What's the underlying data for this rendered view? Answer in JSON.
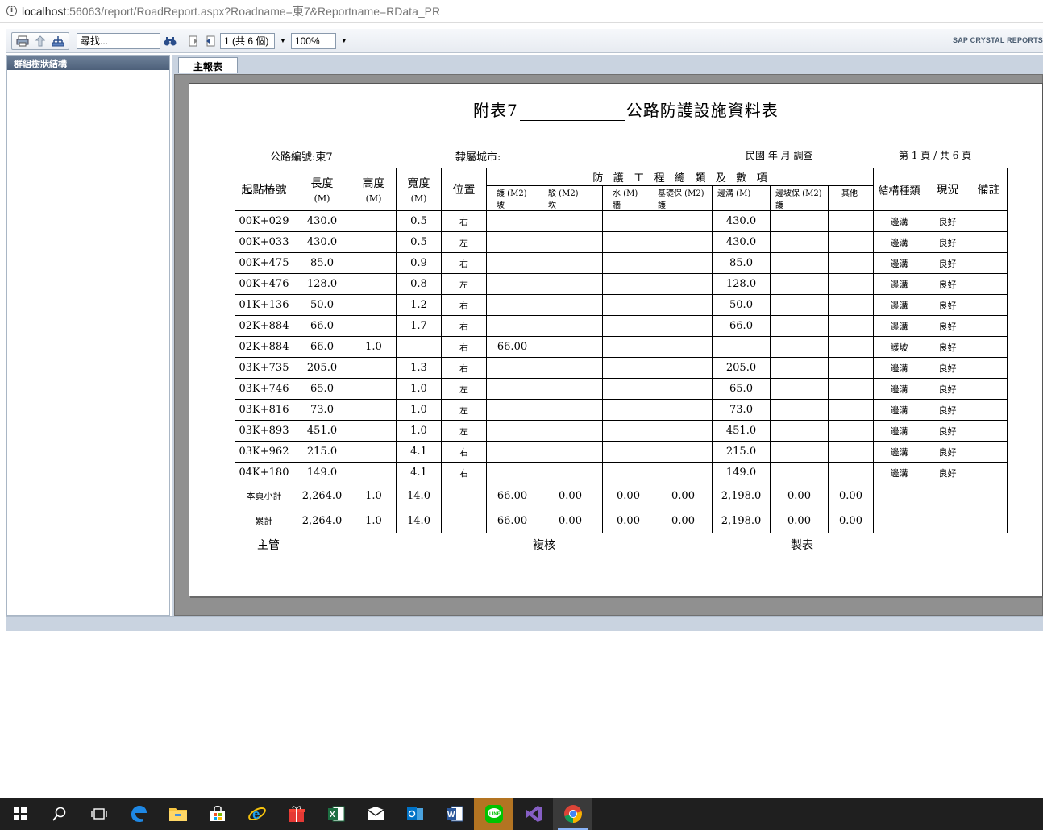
{
  "browser": {
    "url_host": "localhost",
    "url_path": ":56063/report/RoadReport.aspx?Roadname=東7&Reportname=RData_PR"
  },
  "toolbar": {
    "search_value": "尋找...",
    "page_indicator": "1 (共 6 個)",
    "zoom": "100%",
    "brand": "SAP CRYSTAL REPORTS"
  },
  "left_panel": {
    "header": "群組樹狀結構"
  },
  "tabs": {
    "main": "主報表"
  },
  "report": {
    "title_prefix": "附表7",
    "title_suffix": "公路防護設施資料表",
    "road_no": "公路編號:東7",
    "city": "隸屬城市:",
    "survey_date": "民國      年      月 調查",
    "page_info": "第 1 頁 / 共 6 頁",
    "columns": {
      "start": "起點樁號",
      "length": "長度",
      "length_unit": "(M)",
      "height": "高度",
      "height_unit": "(M)",
      "width": "寬度",
      "width_unit": "(M)",
      "position": "位置",
      "group": "防   護   工   程   總   類   及   數   項",
      "sub1": "護 (M2)\n坡",
      "sub2": "駁 (M2)\n坎",
      "sub3": "水 (M)\n牆",
      "sub4": "基礎保 (M2)\n護",
      "sub5": "邊溝 (M)",
      "sub6": "邊坡保 (M2)\n護",
      "sub7": "其他",
      "structure": "結構種類",
      "status": "現況",
      "remark": "備註"
    },
    "rows": [
      {
        "start": "00K+029",
        "length": "430.0",
        "height": "",
        "width": "0.5",
        "pos": "右",
        "c1": "",
        "c2": "",
        "c3": "",
        "c4": "",
        "c5": "430.0",
        "c6": "",
        "c7": "",
        "struct": "邊溝",
        "status": "良好",
        "remark": ""
      },
      {
        "start": "00K+033",
        "length": "430.0",
        "height": "",
        "width": "0.5",
        "pos": "左",
        "c1": "",
        "c2": "",
        "c3": "",
        "c4": "",
        "c5": "430.0",
        "c6": "",
        "c7": "",
        "struct": "邊溝",
        "status": "良好",
        "remark": ""
      },
      {
        "start": "00K+475",
        "length": "85.0",
        "height": "",
        "width": "0.9",
        "pos": "右",
        "c1": "",
        "c2": "",
        "c3": "",
        "c4": "",
        "c5": "85.0",
        "c6": "",
        "c7": "",
        "struct": "邊溝",
        "status": "良好",
        "remark": ""
      },
      {
        "start": "00K+476",
        "length": "128.0",
        "height": "",
        "width": "0.8",
        "pos": "左",
        "c1": "",
        "c2": "",
        "c3": "",
        "c4": "",
        "c5": "128.0",
        "c6": "",
        "c7": "",
        "struct": "邊溝",
        "status": "良好",
        "remark": ""
      },
      {
        "start": "01K+136",
        "length": "50.0",
        "height": "",
        "width": "1.2",
        "pos": "右",
        "c1": "",
        "c2": "",
        "c3": "",
        "c4": "",
        "c5": "50.0",
        "c6": "",
        "c7": "",
        "struct": "邊溝",
        "status": "良好",
        "remark": ""
      },
      {
        "start": "02K+884",
        "length": "66.0",
        "height": "",
        "width": "1.7",
        "pos": "右",
        "c1": "",
        "c2": "",
        "c3": "",
        "c4": "",
        "c5": "66.0",
        "c6": "",
        "c7": "",
        "struct": "邊溝",
        "status": "良好",
        "remark": ""
      },
      {
        "start": "02K+884",
        "length": "66.0",
        "height": "1.0",
        "width": "",
        "pos": "右",
        "c1": "66.00",
        "c2": "",
        "c3": "",
        "c4": "",
        "c5": "",
        "c6": "",
        "c7": "",
        "struct": "護坡",
        "status": "良好",
        "remark": ""
      },
      {
        "start": "03K+735",
        "length": "205.0",
        "height": "",
        "width": "1.3",
        "pos": "右",
        "c1": "",
        "c2": "",
        "c3": "",
        "c4": "",
        "c5": "205.0",
        "c6": "",
        "c7": "",
        "struct": "邊溝",
        "status": "良好",
        "remark": ""
      },
      {
        "start": "03K+746",
        "length": "65.0",
        "height": "",
        "width": "1.0",
        "pos": "左",
        "c1": "",
        "c2": "",
        "c3": "",
        "c4": "",
        "c5": "65.0",
        "c6": "",
        "c7": "",
        "struct": "邊溝",
        "status": "良好",
        "remark": ""
      },
      {
        "start": "03K+816",
        "length": "73.0",
        "height": "",
        "width": "1.0",
        "pos": "左",
        "c1": "",
        "c2": "",
        "c3": "",
        "c4": "",
        "c5": "73.0",
        "c6": "",
        "c7": "",
        "struct": "邊溝",
        "status": "良好",
        "remark": ""
      },
      {
        "start": "03K+893",
        "length": "451.0",
        "height": "",
        "width": "1.0",
        "pos": "左",
        "c1": "",
        "c2": "",
        "c3": "",
        "c4": "",
        "c5": "451.0",
        "c6": "",
        "c7": "",
        "struct": "邊溝",
        "status": "良好",
        "remark": ""
      },
      {
        "start": "03K+962",
        "length": "215.0",
        "height": "",
        "width": "4.1",
        "pos": "右",
        "c1": "",
        "c2": "",
        "c3": "",
        "c4": "",
        "c5": "215.0",
        "c6": "",
        "c7": "",
        "struct": "邊溝",
        "status": "良好",
        "remark": ""
      },
      {
        "start": "04K+180",
        "length": "149.0",
        "height": "",
        "width": "4.1",
        "pos": "右",
        "c1": "",
        "c2": "",
        "c3": "",
        "c4": "",
        "c5": "149.0",
        "c6": "",
        "c7": "",
        "struct": "邊溝",
        "status": "良好",
        "remark": ""
      }
    ],
    "subtotal": {
      "label": "本頁小計",
      "length": "2,264.0",
      "height": "1.0",
      "width": "14.0",
      "c1": "66.00",
      "c2": "0.00",
      "c3": "0.00",
      "c4": "0.00",
      "c5": "2,198.0",
      "c6": "0.00",
      "c7": "0.00"
    },
    "total": {
      "label": "累計",
      "length": "2,264.0",
      "height": "1.0",
      "width": "14.0",
      "c1": "66.00",
      "c2": "0.00",
      "c3": "0.00",
      "c4": "0.00",
      "c5": "2,198.0",
      "c6": "0.00",
      "c7": "0.00"
    },
    "signatures": {
      "manager": "主管",
      "review": "複核",
      "maker": "製表"
    }
  },
  "taskbar": [
    "windows-start",
    "search",
    "task-view",
    "edge",
    "file-explorer",
    "store",
    "internet-explorer",
    "gift-app",
    "excel",
    "mail",
    "outlook",
    "word",
    "line",
    "visual-studio",
    "chrome"
  ]
}
